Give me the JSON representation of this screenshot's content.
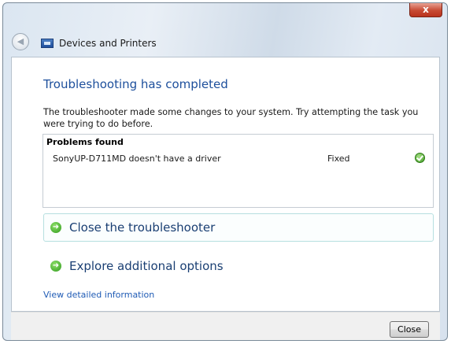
{
  "window": {
    "title": "Devices and Printers",
    "close_glyph": "x"
  },
  "main": {
    "heading": "Troubleshooting has completed",
    "description": "The troubleshooter made some changes to your system. Try attempting the task you were trying to do before.",
    "problems": {
      "title": "Problems found",
      "items": [
        {
          "name": "SonyUP-D711MD doesn't have a driver",
          "status": "Fixed",
          "icon": "check-icon"
        }
      ]
    },
    "commands": {
      "close_label": "Close the troubleshooter",
      "explore_label": "Explore additional options",
      "arrow_icon": "green-arrow-icon"
    },
    "view_details_label": "View detailed information"
  },
  "footer": {
    "close_button_label": "Close"
  },
  "colors": {
    "heading": "#1d4f9c",
    "link": "#1f5bb5",
    "accent_arrow": "#2f9a1c",
    "close_x": "#c74a33"
  }
}
